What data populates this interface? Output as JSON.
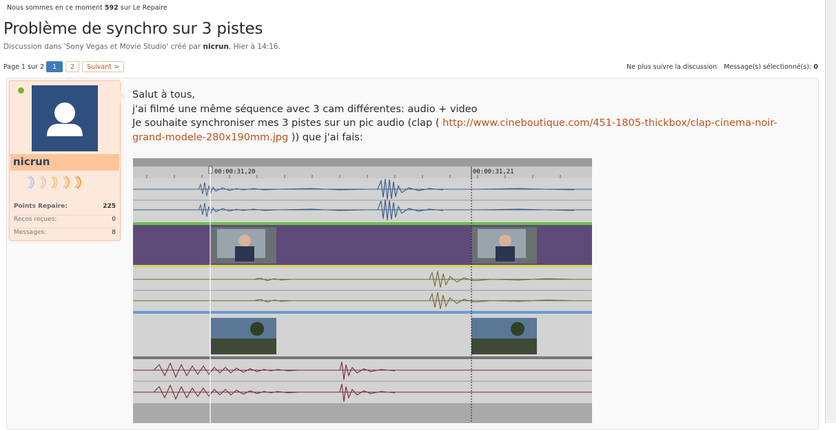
{
  "header": {
    "online_prefix": "Nous sommes en ce moment",
    "online_count": "592",
    "online_suffix": "sur Le Repaire"
  },
  "thread": {
    "title": "Problème de synchro sur 3 pistes",
    "meta_prefix": "Discussion dans 'Sony Vegas et Movie Studio' créé par",
    "meta_author": "nicrun",
    "meta_date": ", Hier à 14:16."
  },
  "pagenav": {
    "label": "Page 1 sur 2",
    "pages": [
      "1",
      "2"
    ],
    "next": "Suivant >"
  },
  "tools": {
    "unwatch": "Ne plus suivre la discussion",
    "selected_label": "Message(s) sélectionné(s):",
    "selected_count": "0"
  },
  "user": {
    "name": "nicrun",
    "stats": [
      {
        "label": "Points Repaire:",
        "value": "225"
      },
      {
        "label": "Recos reçues:",
        "value": "0"
      },
      {
        "label": "Messages:",
        "value": "8"
      }
    ]
  },
  "message": {
    "line1": "Salut à tous,",
    "line2": "j'ai filmé une même séquence avec 3 cam différentes: audio + video",
    "line3_prefix": "Je souhaite synchroniser mes 3 pistes sur un pic audio (clap ( ",
    "link": "http://www.cineboutique.com/451-1805-thickbox/clap-cinema-noir-grand-modele-280x190mm.jpg",
    "line3_suffix": " )) que j'ai fais:"
  },
  "timeline": {
    "time_left": "00:00:31,20",
    "time_right": "00:00:31,21"
  },
  "colors": {
    "link": "#b8541c",
    "accent_blue": "#3d7cba",
    "audio1": "#3e5f8a",
    "video1_bg": "#5e4a78",
    "audio2": "#6e6a2a",
    "audio3": "#7a2a34",
    "usercard_bg": "#fde9dc",
    "online": "#7db81c"
  }
}
